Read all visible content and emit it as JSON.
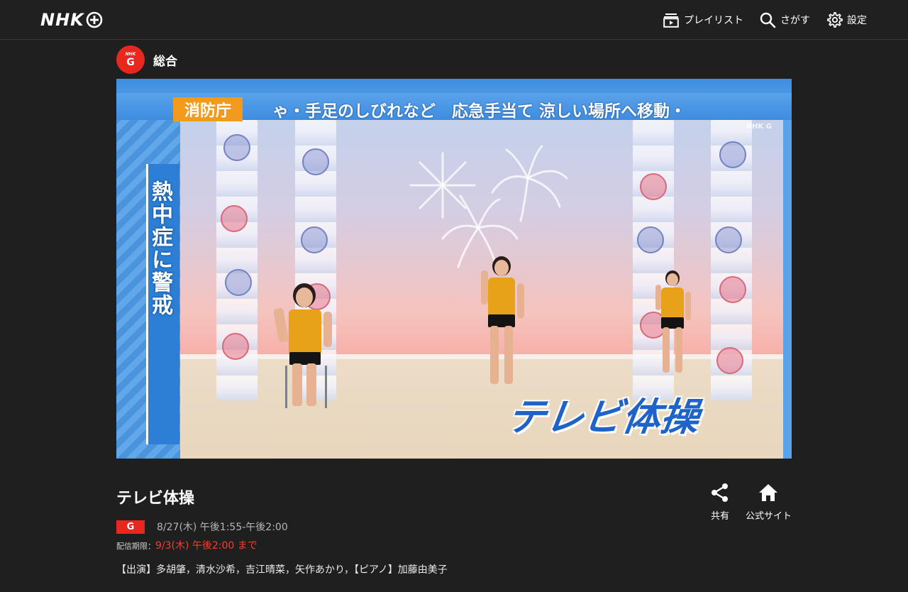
{
  "header": {
    "logo_text": "NHK",
    "nav": {
      "playlist_label": "プレイリスト",
      "search_label": "さがす",
      "settings_label": "設定"
    }
  },
  "channel": {
    "badge_small": "NHK",
    "badge_big": "G",
    "name": "総合"
  },
  "video": {
    "ticker_label": "消防庁",
    "ticker_text": "ゃ・手足のしびれなど　応急手当て 涼しい場所へ移動・",
    "side_caption": "熱中症に警戒",
    "show_logo": "テレビ体操",
    "watermark": "NHK G"
  },
  "program": {
    "title": "テレビ体操",
    "channel_badge": "G",
    "air_time": "8/27(木) 午後1:55-午後2:00",
    "deadline_label": "配信期限：",
    "deadline_value": "9/3(木) 午後2:00 まで",
    "cast": "【出演】多胡肇，清水沙希，吉江晴菜，矢作あかり，【ピアノ】加藤由美子",
    "share_label": "共有",
    "official_site_label": "公式サイト"
  },
  "colors": {
    "background": "#1f1f20",
    "accent_red": "#e8281e",
    "deadline_red": "#ff3a2a"
  }
}
